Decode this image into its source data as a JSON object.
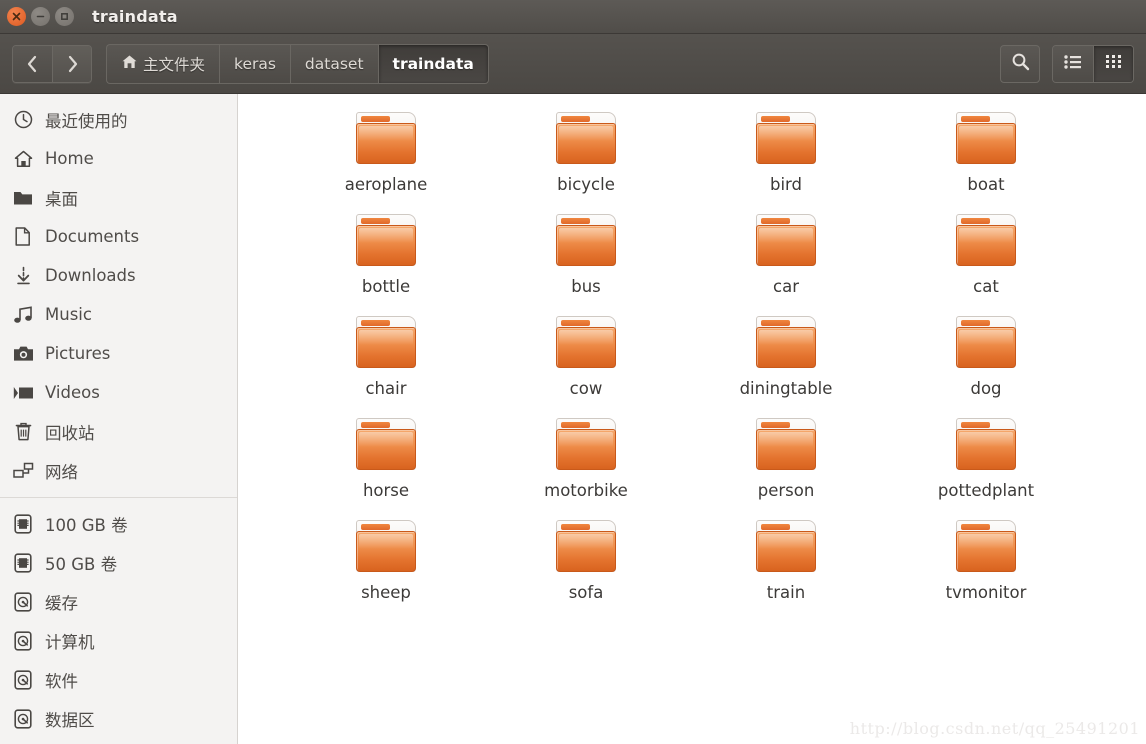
{
  "window": {
    "title": "traindata",
    "controls": [
      {
        "name": "close",
        "glyph": "✕"
      },
      {
        "name": "minimize",
        "glyph": "–"
      },
      {
        "name": "maximize",
        "glyph": "□"
      }
    ]
  },
  "toolbar": {
    "back_label": "‹",
    "forward_label": "›",
    "breadcrumbs": [
      {
        "label": "主文件夹",
        "icon": "home-icon",
        "active": false
      },
      {
        "label": "keras",
        "icon": "",
        "active": false
      },
      {
        "label": "dataset",
        "icon": "",
        "active": false
      },
      {
        "label": "traindata",
        "icon": "",
        "active": true
      }
    ],
    "search_icon": "search-icon",
    "view_list_icon": "list-view-icon",
    "view_grid_icon": "grid-view-icon",
    "active_view": "grid"
  },
  "sidebar": {
    "places": [
      {
        "label": "最近使用的",
        "icon": "clock-icon"
      },
      {
        "label": "Home",
        "icon": "home-icon"
      },
      {
        "label": "桌面",
        "icon": "folder-icon"
      },
      {
        "label": "Documents",
        "icon": "document-icon"
      },
      {
        "label": "Downloads",
        "icon": "download-icon"
      },
      {
        "label": "Music",
        "icon": "music-icon"
      },
      {
        "label": "Pictures",
        "icon": "camera-icon"
      },
      {
        "label": "Videos",
        "icon": "video-icon"
      },
      {
        "label": "回收站",
        "icon": "trash-icon"
      },
      {
        "label": "网络",
        "icon": "network-icon"
      }
    ],
    "devices": [
      {
        "label": "100 GB 卷",
        "icon": "drive-icon"
      },
      {
        "label": "50 GB 卷",
        "icon": "drive-icon"
      },
      {
        "label": "缓存",
        "icon": "harddisk-icon"
      },
      {
        "label": "计算机",
        "icon": "harddisk-icon"
      },
      {
        "label": "软件",
        "icon": "harddisk-icon"
      },
      {
        "label": "数据区",
        "icon": "harddisk-icon"
      }
    ]
  },
  "content": {
    "folders": [
      {
        "name": "aeroplane"
      },
      {
        "name": "bicycle"
      },
      {
        "name": "bird"
      },
      {
        "name": "boat"
      },
      {
        "name": "bottle"
      },
      {
        "name": "bus"
      },
      {
        "name": "car"
      },
      {
        "name": "cat"
      },
      {
        "name": "chair"
      },
      {
        "name": "cow"
      },
      {
        "name": "diningtable"
      },
      {
        "name": "dog"
      },
      {
        "name": "horse"
      },
      {
        "name": "motorbike"
      },
      {
        "name": "person"
      },
      {
        "name": "pottedplant"
      },
      {
        "name": "sheep"
      },
      {
        "name": "sofa"
      },
      {
        "name": "train"
      },
      {
        "name": "tvmonitor"
      }
    ]
  },
  "watermark": {
    "text": "http://blog.csdn.net/qq_25491201"
  },
  "colors": {
    "titlebar": "#55524e",
    "toolbar": "#4f4c48",
    "sidebar_bg": "#f4f3f2",
    "content_bg": "#ffffff",
    "folder_orange": "#e4732e",
    "close_button": "#dd5a21"
  }
}
